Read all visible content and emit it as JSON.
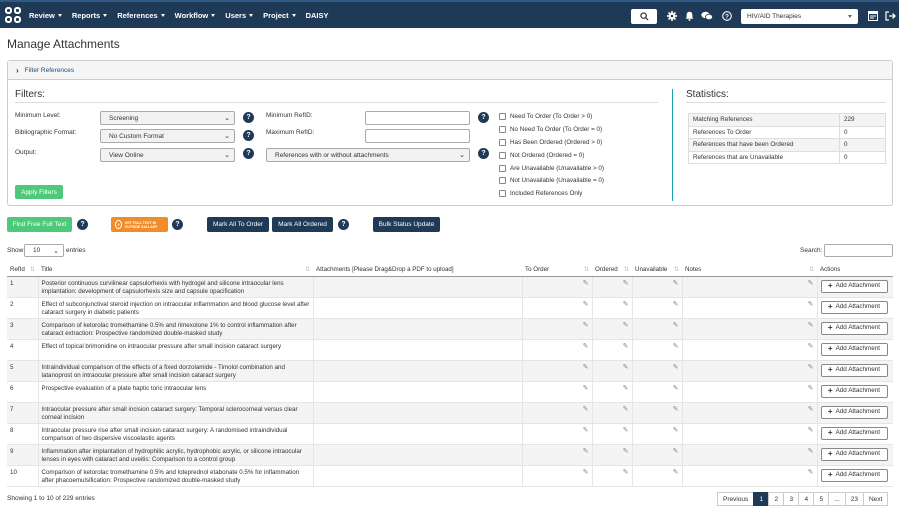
{
  "nav": {
    "items": [
      "Review",
      "Reports",
      "References",
      "Workflow",
      "Users",
      "Project",
      "DAISY"
    ],
    "project": "HIV/AID Therapies"
  },
  "page_title": "Manage Attachments",
  "filter_panel": {
    "header": "Filter References",
    "heading": "Filters:",
    "min_level_label": "Minimum Level:",
    "min_level_value": "Screening",
    "bib_format_label": "Bibliographic Format:",
    "bib_format_value": "No Custom Format",
    "output_label": "Output:",
    "output_value": "View Online",
    "min_refid_label": "Minimum RefID:",
    "max_refid_label": "Maximum RefID:",
    "attachments_value": "References with or without attachments",
    "checkboxes": [
      "Need To Order (To Order > 0)",
      "No Need To Order (To Order = 0)",
      "Has Been Ordered (Ordered > 0)",
      "Not Ordered (Ordered = 0)",
      "Are Unavailable (Unavailable > 0)",
      "Not Unavailable (Unavailable = 0)",
      "Included References Only"
    ],
    "apply_label": "Apply Filters"
  },
  "statistics": {
    "heading": "Statistics:",
    "rows": [
      {
        "label": "Matching References",
        "value": "229"
      },
      {
        "label": "References To Order",
        "value": "0"
      },
      {
        "label": "References that have been Ordered",
        "value": "0"
      },
      {
        "label": "References that are Unavailable",
        "value": "0"
      }
    ]
  },
  "actions": {
    "find_free": "Find Free Full Text",
    "badge_text": "GET FULL TEXT IN OUTSIDE SALLARY",
    "mark_all_to_order": "Mark All To Order",
    "mark_all_ordered": "Mark All Ordered",
    "bulk_status": "Bulk Status Update"
  },
  "table_controls": {
    "show_label": "Show",
    "entries_value": "10",
    "entries_label": "entries",
    "search_label": "Search:"
  },
  "table": {
    "headers": [
      "RefId",
      "Title",
      "Attachments [Please Drag&Drop a PDF to upload]",
      "To Order",
      "Ordered",
      "Unavailable",
      "Notes",
      "Actions"
    ],
    "add_label": "Add Attachment",
    "rows": [
      {
        "id": "1",
        "title": "Posterior continuous curvilinear capsulorhexis with hydrogel and silicone intraocular lens implantation: development of capsulorhexis size and capsule opacification"
      },
      {
        "id": "2",
        "title": "Effect of subconjunctival steroid injection on intraocular inflammation and blood glucose level after cataract surgery in diabetic patients"
      },
      {
        "id": "3",
        "title": "Comparison of ketorolac tromethamine 0.5% and rimexolone 1% to control inflammation after cataract extraction: Prospective randomized double-masked study"
      },
      {
        "id": "4",
        "title": "Effect of topical brimonidine on intraocular pressure after small incision cataract surgery"
      },
      {
        "id": "5",
        "title": "Intraindividual comparison of the effects of a fixed dorzolamide - Timolol combination and latanoprost on intraocular pressure after small incision cataract surgery"
      },
      {
        "id": "6",
        "title": "Prospective evaluation of a plate haptic toric intraocular lens"
      },
      {
        "id": "7",
        "title": "Intraocular pressure after small incision cataract surgery: Temporal sclerocorneal versus clear corneal incision"
      },
      {
        "id": "8",
        "title": "Intraocular pressure rise after small incision cataract surgery: A randomised intraindividual comparison of two dispersive viscoelastic agents"
      },
      {
        "id": "9",
        "title": "Inflammation after implantation of hydrophilic acrylic, hydrophobic acrylic, or silicone intraocular lenses in eyes with cataract and uveitis: Comparison to a control group"
      },
      {
        "id": "10",
        "title": "Comparison of ketorolac tromethamine 0.5% and loteprednol etabonate 0.5% for inflammation after phacoemulsification: Prospective randomized double-masked study"
      }
    ]
  },
  "footer": {
    "showing": "Showing 1 to 10 of 229 entries",
    "pages": [
      "Previous",
      "1",
      "2",
      "3",
      "4",
      "5",
      "...",
      "23",
      "Next"
    ]
  }
}
